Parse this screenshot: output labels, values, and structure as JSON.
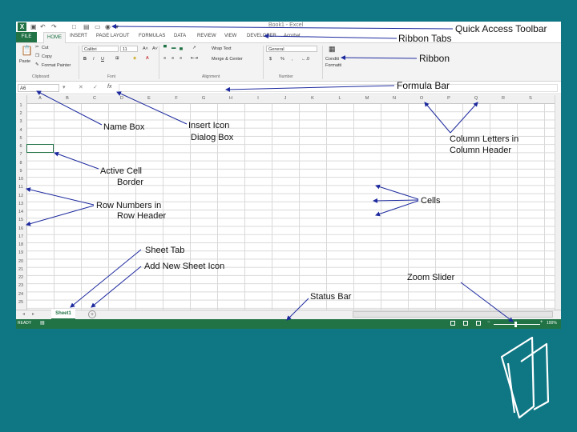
{
  "window": {
    "title": "Book1 - Excel",
    "tabs": [
      "FILE",
      "HOME",
      "INSERT",
      "PAGE LAYOUT",
      "FORMULAS",
      "DATA",
      "REVIEW",
      "VIEW",
      "DEVELOPER",
      "Acrobat"
    ],
    "ribbon": {
      "paste": "Paste",
      "cut": "Cut",
      "copy": "Copy",
      "format_painter": "Format Painter",
      "clipboard_group": "Clipboard",
      "font_name": "Calibri",
      "font_size": "11",
      "font_group": "Font",
      "bold": "B",
      "italic": "I",
      "underline": "U",
      "wrap_text": "Wrap Text",
      "merge_center": "Merge & Center",
      "alignment_group": "Alignment",
      "number_format": "General",
      "currency": "$",
      "percent": "%",
      "number_group": "Number",
      "conditional_1": "Conditi",
      "conditional_2": "Formatti"
    },
    "namebox": "A6",
    "fx": "fx",
    "columns": [
      "A",
      "B",
      "C",
      "D",
      "E",
      "F",
      "G",
      "H",
      "I",
      "J",
      "K",
      "L",
      "M",
      "N",
      "O",
      "P",
      "Q",
      "R",
      "S"
    ],
    "rows": [
      "1",
      "2",
      "3",
      "4",
      "5",
      "6",
      "7",
      "8",
      "9",
      "10",
      "11",
      "12",
      "13",
      "14",
      "15",
      "16",
      "17",
      "18",
      "19",
      "20",
      "21",
      "22",
      "23",
      "24",
      "25"
    ],
    "sheet_tab": "Sheet1",
    "status": "READY",
    "zoom": "100%"
  },
  "annotations": {
    "quick_access": "Quick Access Toolbar",
    "ribbon_tabs": "Ribbon Tabs",
    "ribbon": "Ribbon",
    "formula_bar": "Formula Bar",
    "name_box": "Name Box",
    "insert_icon_1": "Insert Icon",
    "insert_icon_2": "Dialog Box",
    "column_letters_1": "Column Letters in",
    "column_letters_2": "Column Header",
    "active_cell_1": "Active Cell",
    "active_cell_2": "Border",
    "cells": "Cells",
    "row_numbers_1": "Row Numbers in",
    "row_numbers_2": "Row Header",
    "sheet_tab": "Sheet Tab",
    "add_sheet": "Add New Sheet Icon",
    "zoom_slider": "Zoom Slider",
    "status_bar": "Status Bar"
  },
  "colors": {
    "background": "#0f7783",
    "excel_green": "#217346",
    "logo": "#ffffff"
  },
  "icons": [
    "excel-logo-icon",
    "save-icon",
    "undo-icon",
    "redo-icon",
    "paste-icon",
    "fx-icon",
    "add-sheet-icon",
    "decorative-logo-icon"
  ]
}
